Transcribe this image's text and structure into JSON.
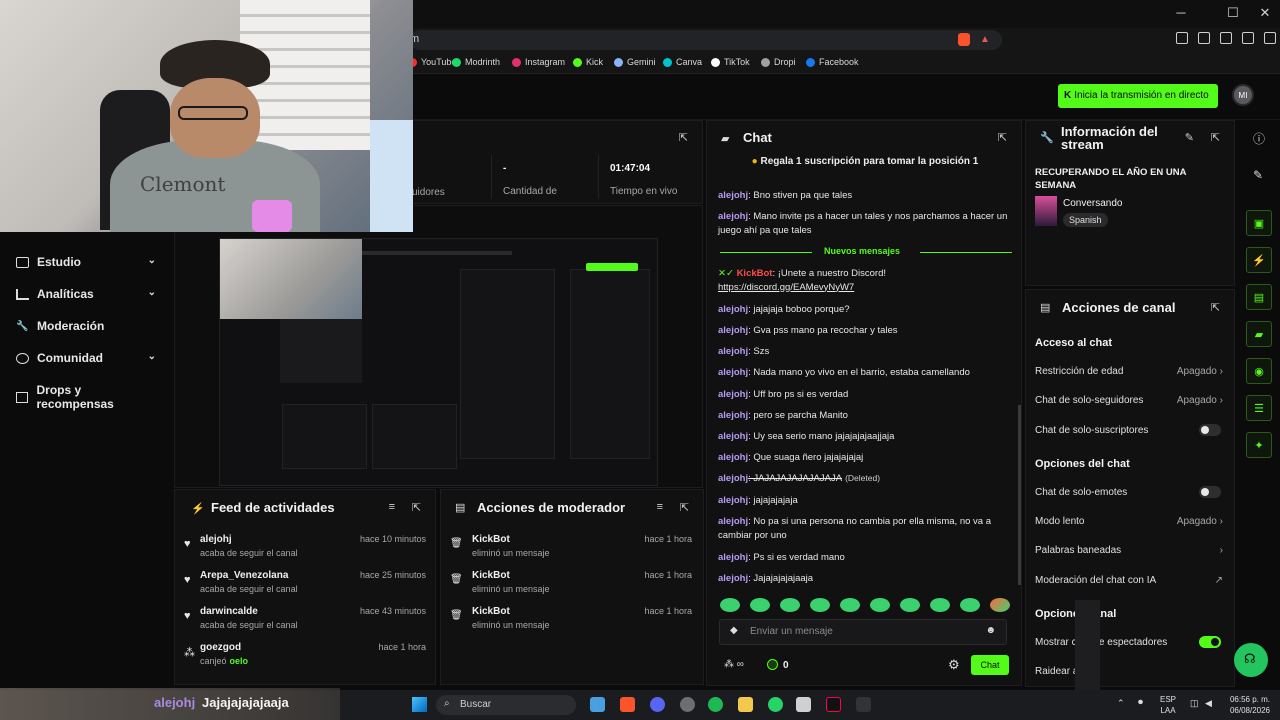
{
  "browser": {
    "url_fragment": "m",
    "bookmarks": [
      {
        "label": "YouTube",
        "color": "#ff2a2a"
      },
      {
        "label": "Modrinth",
        "color": "#1bd96a"
      },
      {
        "label": "Instagram",
        "color": "#e1306c"
      },
      {
        "label": "Kick",
        "color": "#53fc18"
      },
      {
        "label": "Gemini",
        "color": "#8ab4f8"
      },
      {
        "label": "Canva",
        "color": "#00c4cc"
      },
      {
        "label": "TikTok",
        "color": "#ffffff"
      },
      {
        "label": "Dropi",
        "color": "#a0a0a0"
      },
      {
        "label": "Facebook",
        "color": "#1877f2"
      }
    ]
  },
  "header": {
    "go_live": "Inicia la transmisión en directo",
    "avatar": "MI"
  },
  "webcam": {
    "shirt_text": "Clemont"
  },
  "sidebar": {
    "items": [
      {
        "label": "Estudio",
        "chevron": true
      },
      {
        "label": "Analíticas",
        "chevron": true
      },
      {
        "label": "Moderación",
        "chevron": false
      },
      {
        "label": "Comunidad",
        "chevron": true
      },
      {
        "label": "Drops y recompensas",
        "chevron": false
      }
    ]
  },
  "stats": {
    "followers_label": "uidores",
    "count_value": "-",
    "count_label": "Cantidad de",
    "live_value": "01:47:04",
    "live_label": "Tiempo en vivo"
  },
  "activity_feed": {
    "title": "Feed de actividades",
    "items": [
      {
        "name": "alejohj",
        "sub": "acaba de seguir el canal",
        "time": "hace 10 minutos"
      },
      {
        "name": "Arepa_Venezolana",
        "sub": "acaba de seguir el canal",
        "time": "hace 25 minutos"
      },
      {
        "name": "darwincalde",
        "sub": "acaba de seguir el canal",
        "time": "hace 43 minutos"
      },
      {
        "name": "goezgod",
        "sub_prefix": "canjeó",
        "sub_value": "oelo",
        "time": "hace 1 hora"
      }
    ]
  },
  "mod_actions": {
    "title": "Acciones de moderador",
    "items": [
      {
        "name": "KickBot",
        "sub": "eliminó un mensaje",
        "time": "hace 1 hora"
      },
      {
        "name": "KickBot",
        "sub": "eliminó un mensaje",
        "time": "hace 1 hora"
      },
      {
        "name": "KickBot",
        "sub": "eliminó un mensaje",
        "time": "hace 1 hora"
      }
    ]
  },
  "chat": {
    "title": "Chat",
    "pinned": "Regala 1 suscripción para tomar la posición 1",
    "new_messages": "Nuevos mensajes",
    "messages": [
      {
        "user": "alejohj",
        "text": ": Bno stiven pa que tales"
      },
      {
        "user": "alejohj",
        "text": ": Mano invite ps a hacer un tales y nos parchamos a hacer un juego ahí pa que tales"
      },
      {
        "user": "KickBot",
        "text": ": ¡Unete a nuestro Discord!",
        "link": "https://discord.gg/EAMevyNyW7"
      },
      {
        "user": "alejohj",
        "text": ": jajajaja boboo porque?"
      },
      {
        "user": "alejohj",
        "text": ": Gva pss mano pa recochar y tales"
      },
      {
        "user": "alejohj",
        "text": ": Szs"
      },
      {
        "user": "alejohj",
        "text": ": Nada mano yo vivo en el barrio, estaba camellando"
      },
      {
        "user": "alejohj",
        "text": ": Uff bro ps si es verdad"
      },
      {
        "user": "alejohj",
        "text": ": pero se parcha Manito"
      },
      {
        "user": "alejohj",
        "text": ": Uy sea serio mano jajajajajaajjaja"
      },
      {
        "user": "alejohj",
        "text": ": Que suaga ñero jajajajajaj"
      },
      {
        "user": "alejohj",
        "text": ": JAJAJAJAJAJAJAJA",
        "deleted": "(Deleted)"
      },
      {
        "user": "alejohj",
        "text": ": jajajajajaja"
      },
      {
        "user": "alejohj",
        "text": ": No pa si una persona no cambia por ella misma, no va a cambiar por uno"
      },
      {
        "user": "alejohj",
        "text": ": Ps si es verdad mano"
      },
      {
        "user": "alejohj",
        "text": ": Jajajajajajaaja"
      }
    ],
    "input_placeholder": "Enviar un mensaje",
    "viewer_count": "0",
    "send_label": "Chat"
  },
  "stream_info": {
    "title": "Información del stream",
    "stream_title": "RECUPERANDO EL AÑO EN UNA SEMANA",
    "category": "Conversando",
    "language": "Spanish"
  },
  "channel_actions": {
    "title": "Acciones de canal",
    "chat_access": "Acceso al chat",
    "age_restriction": {
      "label": "Restricción de edad",
      "value": "Apagado"
    },
    "followers_only": {
      "label": "Chat de solo-seguidores",
      "value": "Apagado"
    },
    "subs_only": {
      "label": "Chat de solo-suscriptores",
      "on": false
    },
    "chat_options": "Opciones del chat",
    "emotes_only": {
      "label": "Chat de solo-emotes",
      "on": false
    },
    "slow_mode": {
      "label": "Modo lento",
      "value": "Apagado"
    },
    "banned_words": {
      "label": "Palabras baneadas"
    },
    "ai_moderation": {
      "label": "Moderación del chat con IA"
    },
    "channel_options": "Opcione   l canal",
    "show_viewers": {
      "label": "Mostrar c    ad de espectadores",
      "on": true
    },
    "raid": {
      "label": "Raidear a     anal"
    }
  },
  "overlay": {
    "user": "alejohj",
    "text": "Jajajajajajaaja"
  },
  "taskbar": {
    "search": "Buscar",
    "lang": "ESP",
    "lang2": "LAA",
    "time": "06:56 p. m.",
    "date": "06/08/2026"
  }
}
